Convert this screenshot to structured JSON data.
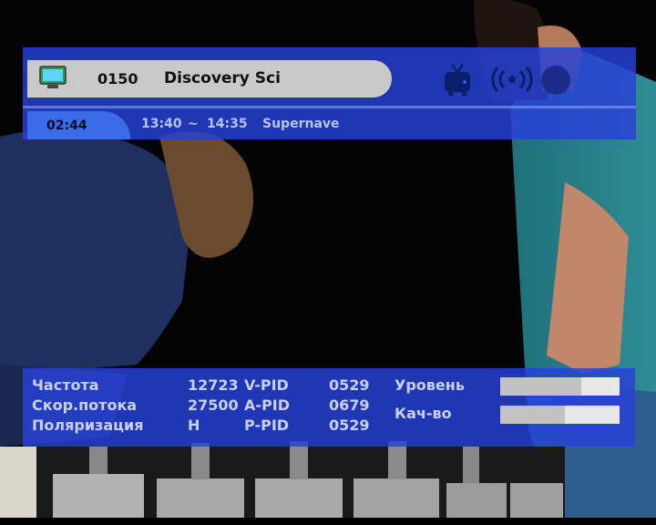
{
  "channel": {
    "number": "0150",
    "name": "Discovery  Sci",
    "current_time": "02:44",
    "event_start": "13:40",
    "event_separator": "~",
    "event_end": "14:35",
    "event_title": "Supernave",
    "icons": [
      "tv-screen-icon",
      "tv-icon",
      "signal-broadcast-icon",
      "globe-icon"
    ]
  },
  "info": {
    "frequency_label": "Частота",
    "frequency_value": "12723",
    "symbol_rate_label": "Скор.потока",
    "symbol_rate_value": "27500",
    "polarization_label": "Поляризация",
    "polarization_value": "H",
    "vpid_label": "V-PID",
    "vpid_value": "0529",
    "apid_label": "A-PID",
    "apid_value": "0679",
    "ppid_label": "P-PID",
    "ppid_value": "0529",
    "level_label": "Уровень",
    "level_fraction": 0.68,
    "quality_label": "Кач-во",
    "quality_fraction": 0.54
  },
  "colors": {
    "panel": "#2642d6",
    "text": "#c8cff4",
    "pill": "#c9c9c9"
  }
}
